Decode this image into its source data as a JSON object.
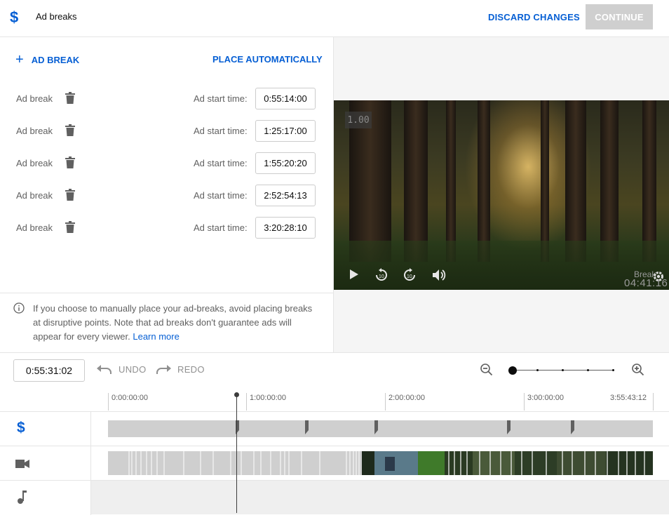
{
  "header": {
    "title": "Ad breaks",
    "discard_label": "DISCARD CHANGES",
    "continue_label": "CONTINUE"
  },
  "left": {
    "add_break_label": "AD BREAK",
    "place_auto_label": "PLACE AUTOMATICALLY",
    "breaks": [
      {
        "label": "Ad break",
        "start_label": "Ad start time:",
        "time": "0:55:14:00"
      },
      {
        "label": "Ad break",
        "start_label": "Ad start time:",
        "time": "1:25:17:00"
      },
      {
        "label": "Ad break",
        "start_label": "Ad start time:",
        "time": "1:55:20:20"
      },
      {
        "label": "Ad break",
        "start_label": "Ad start time:",
        "time": "2:52:54:13"
      },
      {
        "label": "Ad break",
        "start_label": "Ad start time:",
        "time": "3:20:28:10"
      }
    ],
    "info_text": "If you choose to manually place your ad-breaks, avoid placing breaks at disruptive points. Note that ad breaks don't guarantee ads will appear for every viewer.",
    "learn_more": "Learn more"
  },
  "player": {
    "speed": "1.00",
    "break_label": "Break",
    "break_time": "04:41:16"
  },
  "toolbar": {
    "current_time": "0:55:31:02",
    "undo_label": "UNDO",
    "redo_label": "REDO",
    "zoom_level_fraction": 0
  },
  "timeline": {
    "ruler_labels": [
      "0:00:00:00",
      "1:00:00:00",
      "2:00:00:00",
      "3:00:00:00",
      "3:55:43:12"
    ],
    "playhead_time": "0:55:31:02"
  },
  "colors": {
    "accent": "#065fd4",
    "disabled_button": "#cfcfcf",
    "track_grey": "#cfcfcf"
  },
  "icons": {
    "header": "dollar-icon",
    "add": "plus-icon",
    "delete": "trash-icon",
    "info": "info-icon",
    "play": "play-icon",
    "rewind": "replay-10-icon",
    "forward": "forward-10-icon",
    "volume": "volume-icon",
    "settings": "gear-icon",
    "zoom_out": "zoom-out-icon",
    "zoom_in": "zoom-in-icon",
    "undo": "undo-icon",
    "redo": "redo-icon",
    "track_ads": "dollar-icon",
    "track_video": "video-camera-icon",
    "track_audio": "music-note-icon"
  }
}
